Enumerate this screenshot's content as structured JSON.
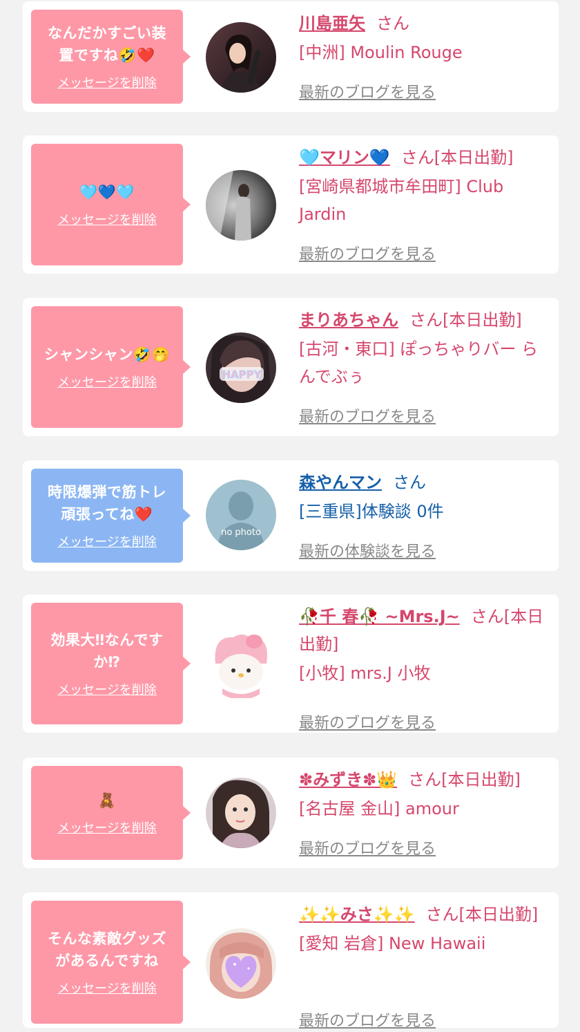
{
  "colors": {
    "background": "#f2f2f2",
    "card": "#ffffff",
    "pink_bubble": "#fe98a7",
    "blue_bubble": "#8cb6f3",
    "name_pink": "#d5476c",
    "name_blue": "#155fa8",
    "link_gray": "#888888"
  },
  "items": [
    {
      "message": "なんだかすごい装\n置ですね🤣❤️",
      "delete_label": "メッセージを削除",
      "name": "川島亜矢",
      "honorific": "さん",
      "shop": "[中洲] Moulin Rouge",
      "blog_link": "最新のブログを見る",
      "bubble_color": "pink",
      "avatar_icon": "woman-photo-avatar"
    },
    {
      "message": "🩵💙🩵",
      "delete_label": "メッセージを削除",
      "name": "🩵マリン💙",
      "honorific": "さん[本日出勤]",
      "shop": "[宮崎県都城市牟田町] Club Jardin",
      "blog_link": "最新のブログを見る",
      "bubble_color": "pink",
      "avatar_icon": "woman-photo-avatar"
    },
    {
      "message": "シャンシャン🤣🤭",
      "delete_label": "メッセージを削除",
      "name": "まりあちゃん",
      "honorific": "さん[本日出勤]",
      "shop": "[古河・東口] ぽっちゃりバー らんでぶぅ",
      "blog_link": "最新のブログを見る",
      "bubble_color": "pink",
      "avatar_icon": "happy-photo-avatar"
    },
    {
      "message": "時限爆弾で筋トレ\n頑張ってね❤️",
      "delete_label": "メッセージを削除",
      "name": "森やんマン",
      "honorific": "さん",
      "shop": "[三重県]体験談 0件",
      "blog_link": "最新の体験談を見る",
      "bubble_color": "blue",
      "avatar_icon": "no-photo-avatar",
      "avatar_text": "no photo"
    },
    {
      "message": "効果大‼なんです\nか⁉",
      "delete_label": "メッセージを削除",
      "name": "🥀千 春🥀 ~Mrs.J~",
      "honorific": "さん[本日出勤]",
      "shop": "[小牧] mrs.J 小牧",
      "blog_link": "最新のブログを見る",
      "bubble_color": "pink",
      "avatar_icon": "plush-toy-avatar"
    },
    {
      "message": "🧸",
      "delete_label": "メッセージを削除",
      "name": "✽みずき✽👑",
      "honorific": "さん[本日出勤]",
      "shop": "[名古屋 金山] amour",
      "blog_link": "最新のブログを見る",
      "bubble_color": "pink",
      "avatar_icon": "woman-photo-avatar"
    },
    {
      "message": "そんな素敵グッズ\nがあるんですね",
      "delete_label": "メッセージを削除",
      "name": "✨✨みさ✨✨",
      "honorific": "さん[本日出勤]",
      "shop": "[愛知 岩倉] New Hawaii",
      "blog_link": "最新のブログを見る",
      "bubble_color": "pink",
      "avatar_icon": "heart-face-avatar"
    }
  ]
}
